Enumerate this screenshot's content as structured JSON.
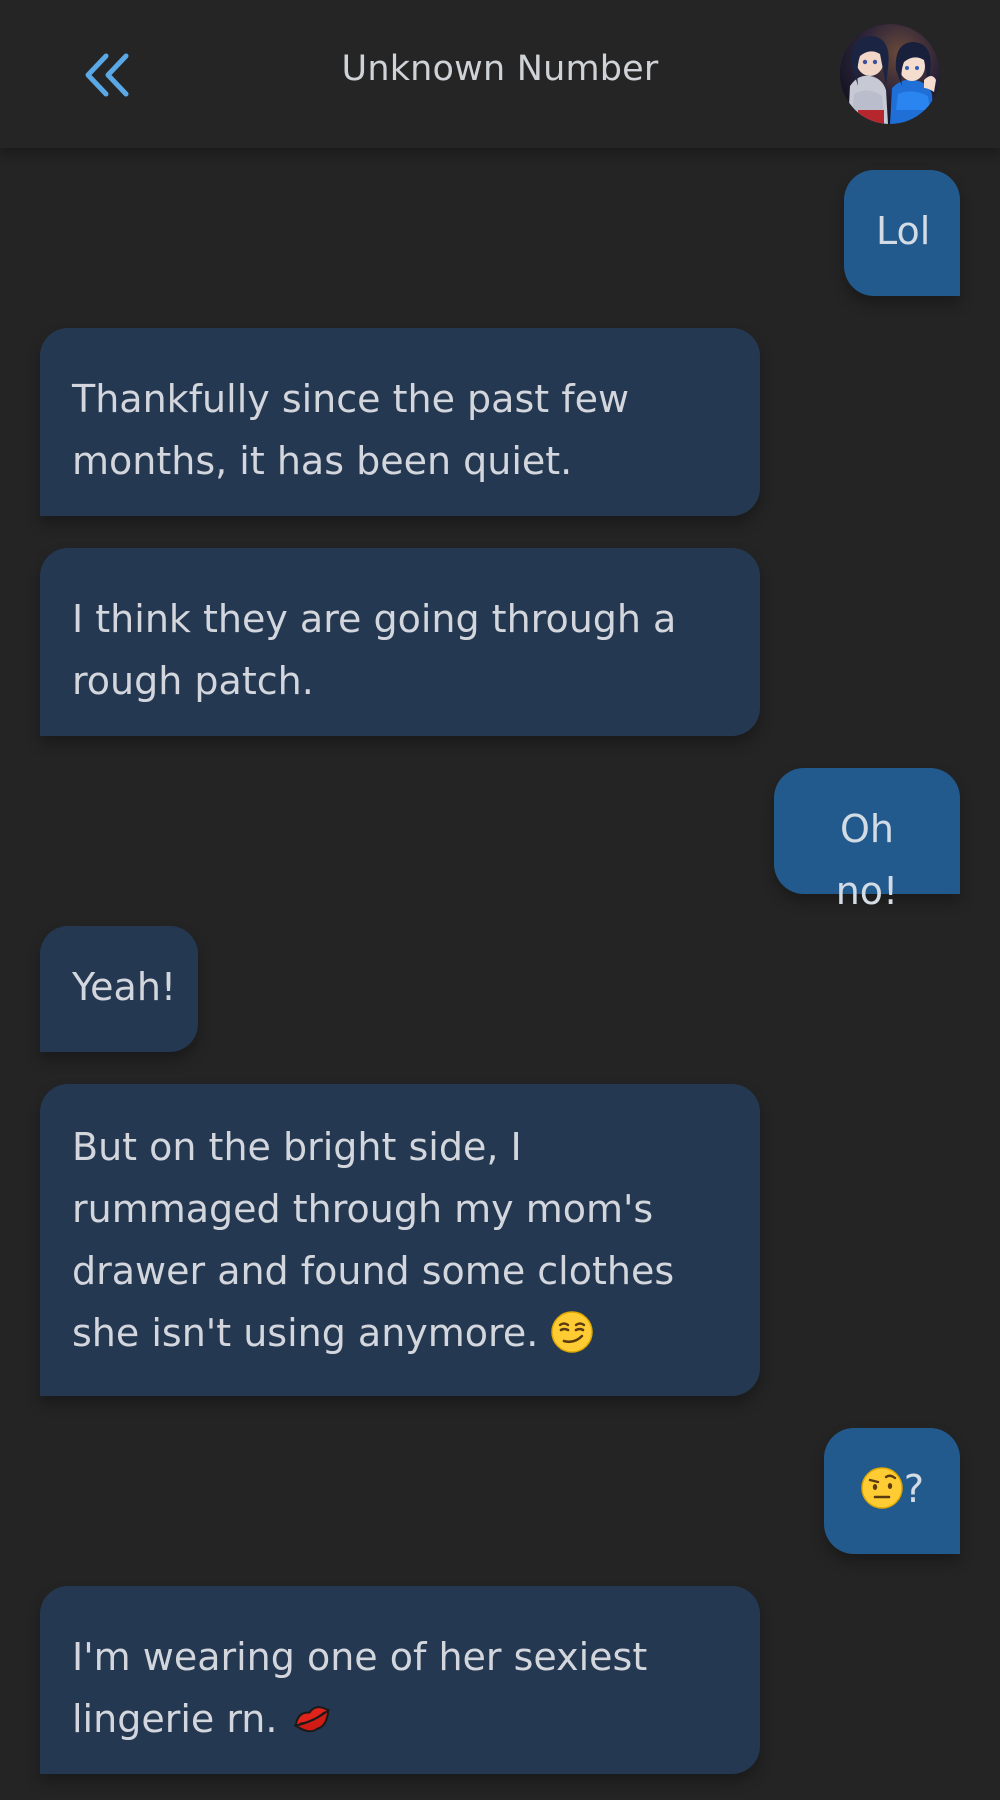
{
  "header": {
    "title": "Unknown Number",
    "back_icon": "double-chevron-left-icon",
    "avatar": "contact-avatar"
  },
  "messages": [
    {
      "direction": "out",
      "text": "Lol"
    },
    {
      "direction": "in",
      "text": "Thankfully since the past few months, it has been quiet."
    },
    {
      "direction": "in",
      "text": "I think they are going through a rough patch."
    },
    {
      "direction": "out",
      "text": "Oh no!"
    },
    {
      "direction": "in",
      "text": "Yeah!"
    },
    {
      "direction": "in",
      "text": "But on the bright side, I rummaged through my mom's drawer and found some clothes she isn't using anymore.",
      "emoji": "smirking-face-emoji"
    },
    {
      "direction": "out",
      "text": "?",
      "emoji": "face-with-raised-eyebrow-emoji"
    },
    {
      "direction": "in",
      "text": "I'm wearing one of her sexiest lingerie rn.",
      "emoji": "kiss-mark-emoji"
    }
  ],
  "colors": {
    "background": "#242424",
    "incoming_bubble": "#243851",
    "outgoing_bubble": "#225a8e",
    "accent": "#5aa9e6"
  }
}
